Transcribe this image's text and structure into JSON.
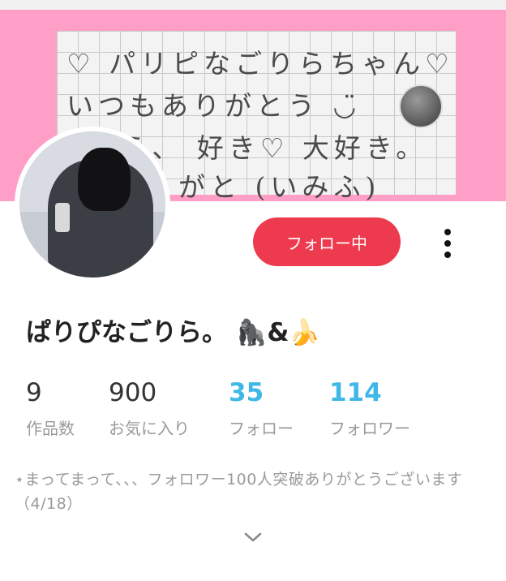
{
  "header": {
    "note_lines": [
      "♡ パリピなごりらちゃん♡",
      "いつもありがとう ◡̈",
      "くう、 好き♡ 大好き。",
      "がと (いみふ)"
    ]
  },
  "profile": {
    "username": "ぱりぴなごりら。 🦍&🍌",
    "follow_button": "フォロー中"
  },
  "stats": [
    {
      "value": "9",
      "label": "作品数"
    },
    {
      "value": "900",
      "label": "お気に入り"
    },
    {
      "value": "35",
      "label": "フォロー"
    },
    {
      "value": "114",
      "label": "フォロワー"
    }
  ],
  "bio": "⋆まってまって、、、フォロワー100人突破ありがとうございます（4/18）",
  "colors": {
    "header_pink": "#ff9ec6",
    "follow_button": "#ee3a4e",
    "stat_link_blue": "#3fb8e8"
  }
}
